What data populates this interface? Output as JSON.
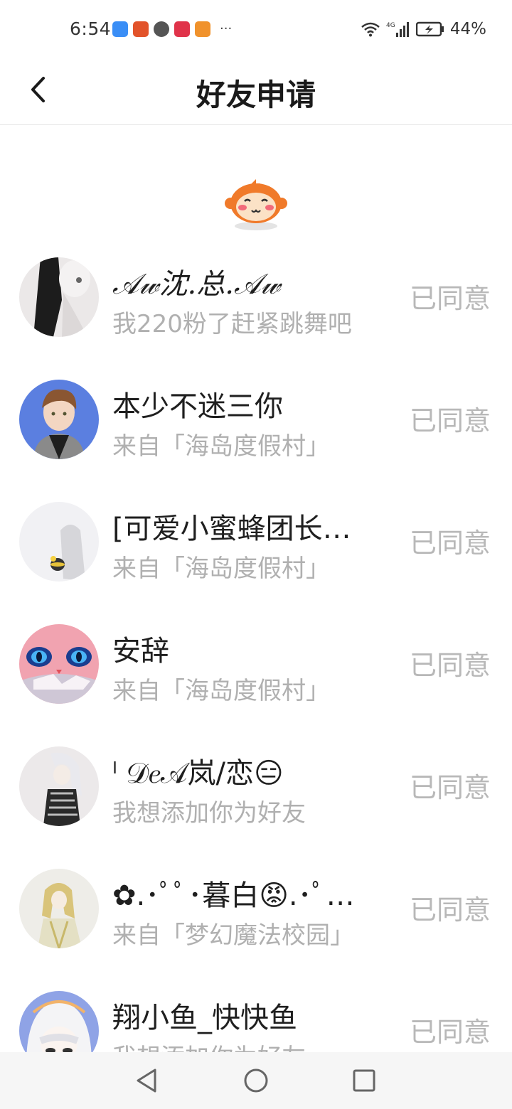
{
  "status_bar": {
    "time": "6:54",
    "more": "···",
    "battery": "44%",
    "network": "4G"
  },
  "header": {
    "title": "好友申请",
    "back_icon": "chevron-left-icon"
  },
  "requests": [
    {
      "name": "𝒜𝓌沈.总.𝒜𝓌",
      "subtitle": "我220粉了赶紧跳舞吧",
      "status": "已同意"
    },
    {
      "name": "本少不迷三你",
      "subtitle": "来自「海岛度假村」",
      "status": "已同意"
    },
    {
      "name": "[可爱小蜜蜂团长…",
      "subtitle": "来自「海岛度假村」",
      "status": "已同意"
    },
    {
      "name": "安辞",
      "subtitle": "来自「海岛度假村」",
      "status": "已同意"
    },
    {
      "name": "ˡ 𝒟𝑒𝒜岚/恋😑",
      "subtitle": "我想添加你为好友",
      "status": "已同意"
    },
    {
      "name": "✿.･ﾟﾟ･暮白😡.･ﾟ…",
      "subtitle": "来自「梦幻魔法校园」",
      "status": "已同意"
    },
    {
      "name": "翔小鱼_快快鱼",
      "subtitle": "我想添加你为好友",
      "status": "已同意"
    }
  ],
  "colors": {
    "accepted_text": "#b8b8b8",
    "subtitle_text": "#b0b0b0",
    "mascot_orange": "#f07a2a"
  }
}
